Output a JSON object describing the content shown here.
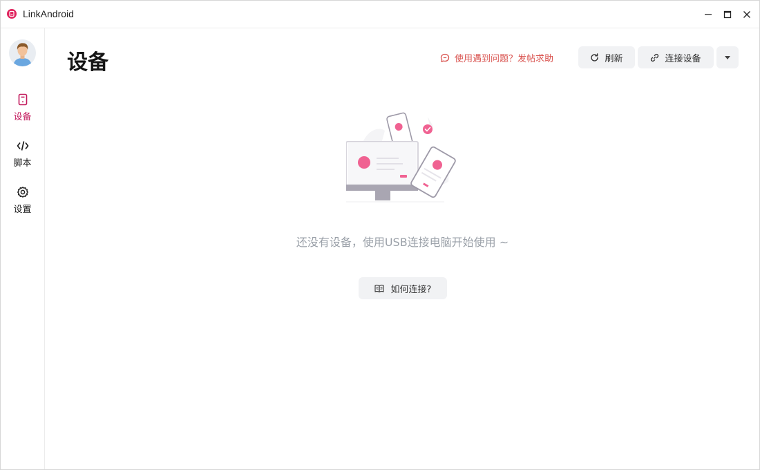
{
  "window": {
    "title": "LinkAndroid",
    "controls": {
      "minimize": "minimize-icon",
      "maximize": "maximize-icon",
      "close": "close-icon"
    }
  },
  "sidebar": {
    "avatar_icon": "avatar-icon",
    "items": [
      {
        "label": "设备",
        "icon": "device-icon",
        "active": true
      },
      {
        "label": "脚本",
        "icon": "code-icon",
        "active": false
      },
      {
        "label": "设置",
        "icon": "gear-icon",
        "active": false
      }
    ]
  },
  "header": {
    "title": "设备",
    "help_link": "使用遇到问题？发帖求助",
    "refresh_label": "刷新",
    "connect_label": "连接设备",
    "more_icon": "caret-down-icon"
  },
  "empty_state": {
    "message": "还没有设备，使用USB连接电脑开始使用 ~",
    "howto_label": "如何连接?"
  },
  "colors": {
    "accent": "#c2185b",
    "help": "#d9534f",
    "illustration_pink": "#f06292",
    "button_bg": "#f1f2f4",
    "muted_text": "#9aa0a8"
  }
}
